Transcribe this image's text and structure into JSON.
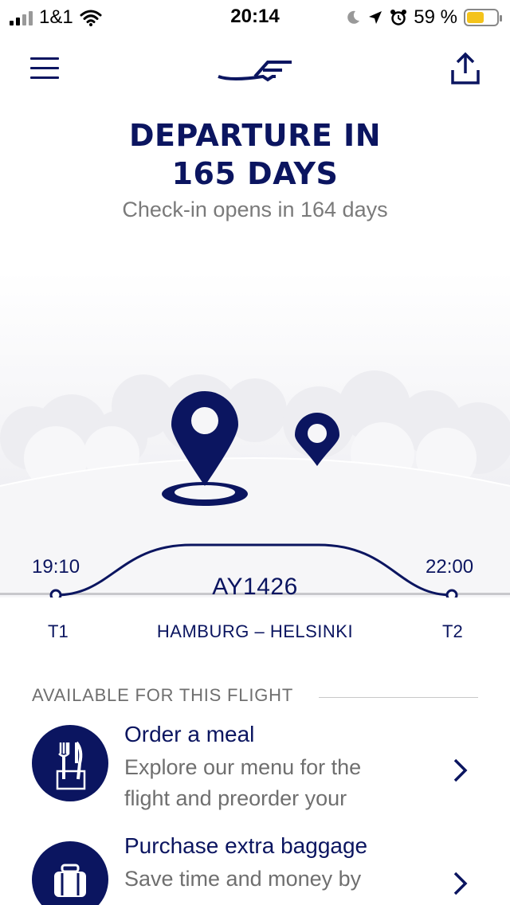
{
  "status": {
    "carrier": "1&1",
    "time": "20:14",
    "battery": "59 %",
    "battery_level": 0.59
  },
  "header": {
    "title_line1": "DEPARTURE IN",
    "title_line2": "165 DAYS",
    "subtitle": "Check-in opens in 164 days"
  },
  "flight": {
    "departure_time": "19:10",
    "arrival_time": "22:00",
    "number": "AY1426",
    "departure_terminal": "T1",
    "arrival_terminal": "T2",
    "route": "HAMBURG – HELSINKI"
  },
  "section": {
    "title": "AVAILABLE FOR THIS FLIGHT",
    "items": [
      {
        "title": "Order a meal",
        "description": "Explore our menu for the flight and preorder your",
        "icon": "meal-icon"
      },
      {
        "title": "Purchase extra baggage",
        "description": "Save time and money by",
        "icon": "baggage-icon"
      }
    ]
  },
  "colors": {
    "brand": "#0b1560",
    "muted": "#6f6f6f"
  }
}
